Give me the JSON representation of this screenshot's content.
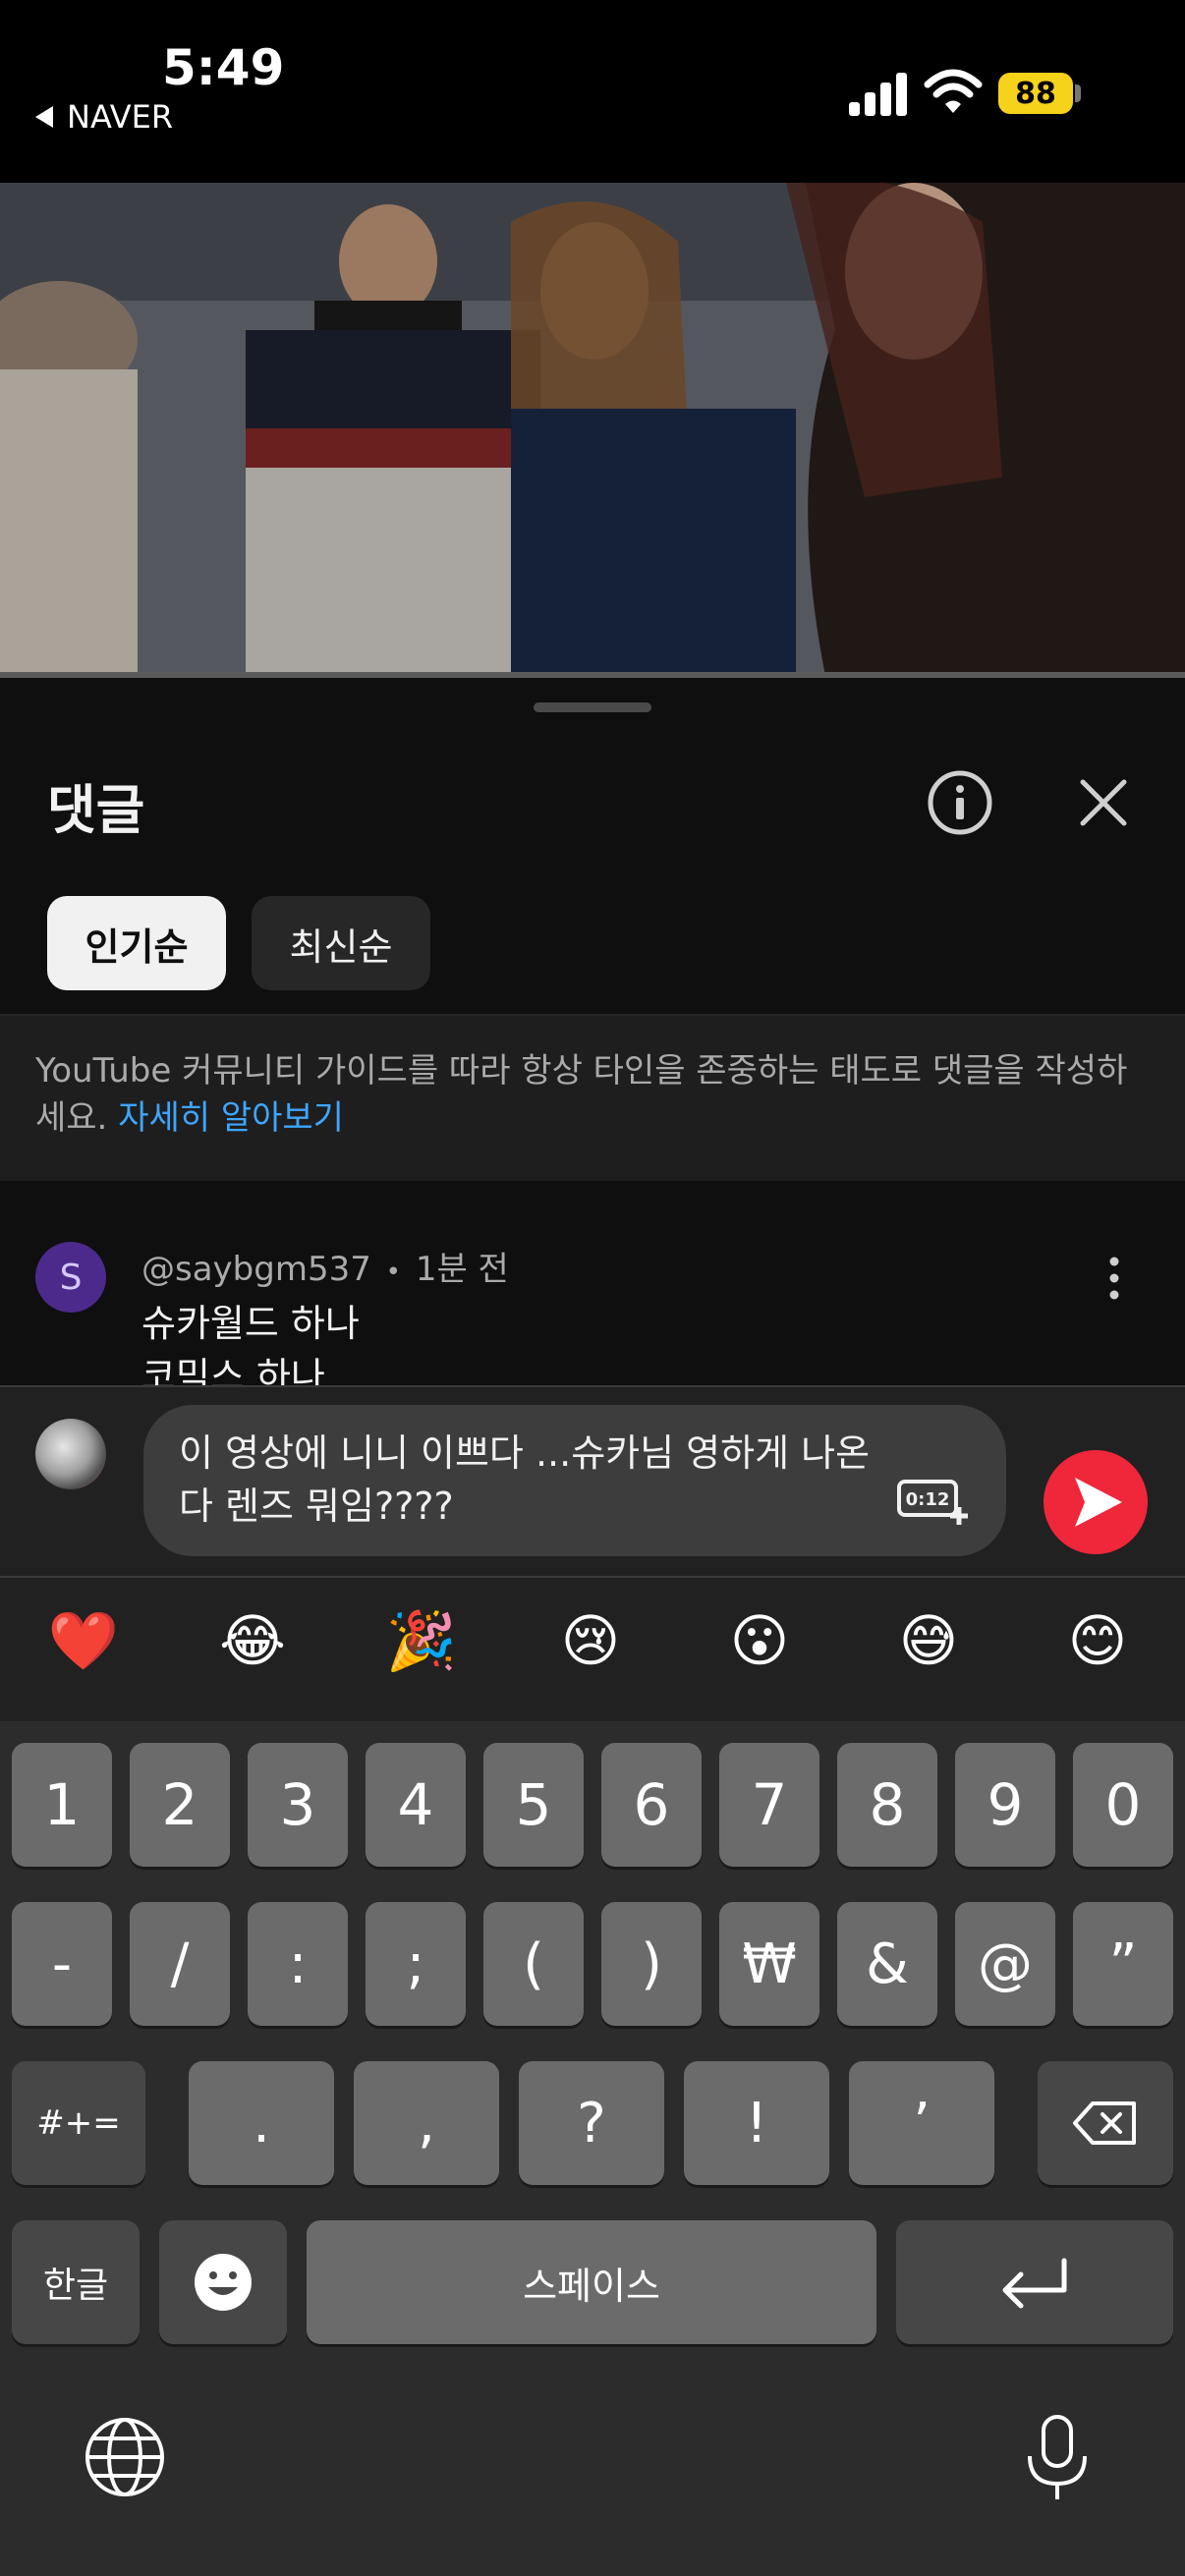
{
  "status_bar": {
    "time": "5:49",
    "back_app": "NAVER",
    "battery": "88",
    "colors": {
      "battery": "#f7d21a"
    }
  },
  "comments_panel": {
    "title": "댓글",
    "info_icon": "info-icon",
    "close_icon": "close-icon",
    "sort_chips": [
      {
        "label": "인기순",
        "active": true
      },
      {
        "label": "최신순",
        "active": false
      }
    ],
    "guideline": {
      "text": "YouTube 커뮤니티 가이드를 따라 항상 타인을 존중하는 태도로 댓글을 작성하세요.",
      "link": "자세히 알아보기"
    },
    "comment": {
      "avatar_letter": "S",
      "author": "@saybgm537",
      "separator": "•",
      "time": "1분 전",
      "text_line1": "슈카월드 하나",
      "text_line2": "코믹스 하나"
    }
  },
  "input": {
    "value": "이 영상에 니니 이쁘다 ...슈카님 영하게 나온다 렌즈 뭐임????",
    "timestamp": "0:12",
    "send_icon": "send-icon",
    "colors": {
      "send": "#f0263a"
    }
  },
  "emoji_bar": [
    "❤️",
    "😂",
    "🎉",
    "😢",
    "😮",
    "😅",
    "😊"
  ],
  "keyboard": {
    "row1": [
      "1",
      "2",
      "3",
      "4",
      "5",
      "6",
      "7",
      "8",
      "9",
      "0"
    ],
    "row2": [
      "-",
      "/",
      ":",
      ";",
      "(",
      ")",
      "₩",
      "&",
      "@",
      "”"
    ],
    "row3_left": "#+=",
    "row3": [
      ".",
      ",",
      "?",
      "!",
      "’"
    ],
    "backspace_icon": "backspace-icon",
    "lang": "한글",
    "emoji_key_icon": "smiley-icon",
    "space": "스페이스",
    "return_icon": "return-icon",
    "globe_icon": "globe-icon",
    "mic_icon": "microphone-icon"
  }
}
